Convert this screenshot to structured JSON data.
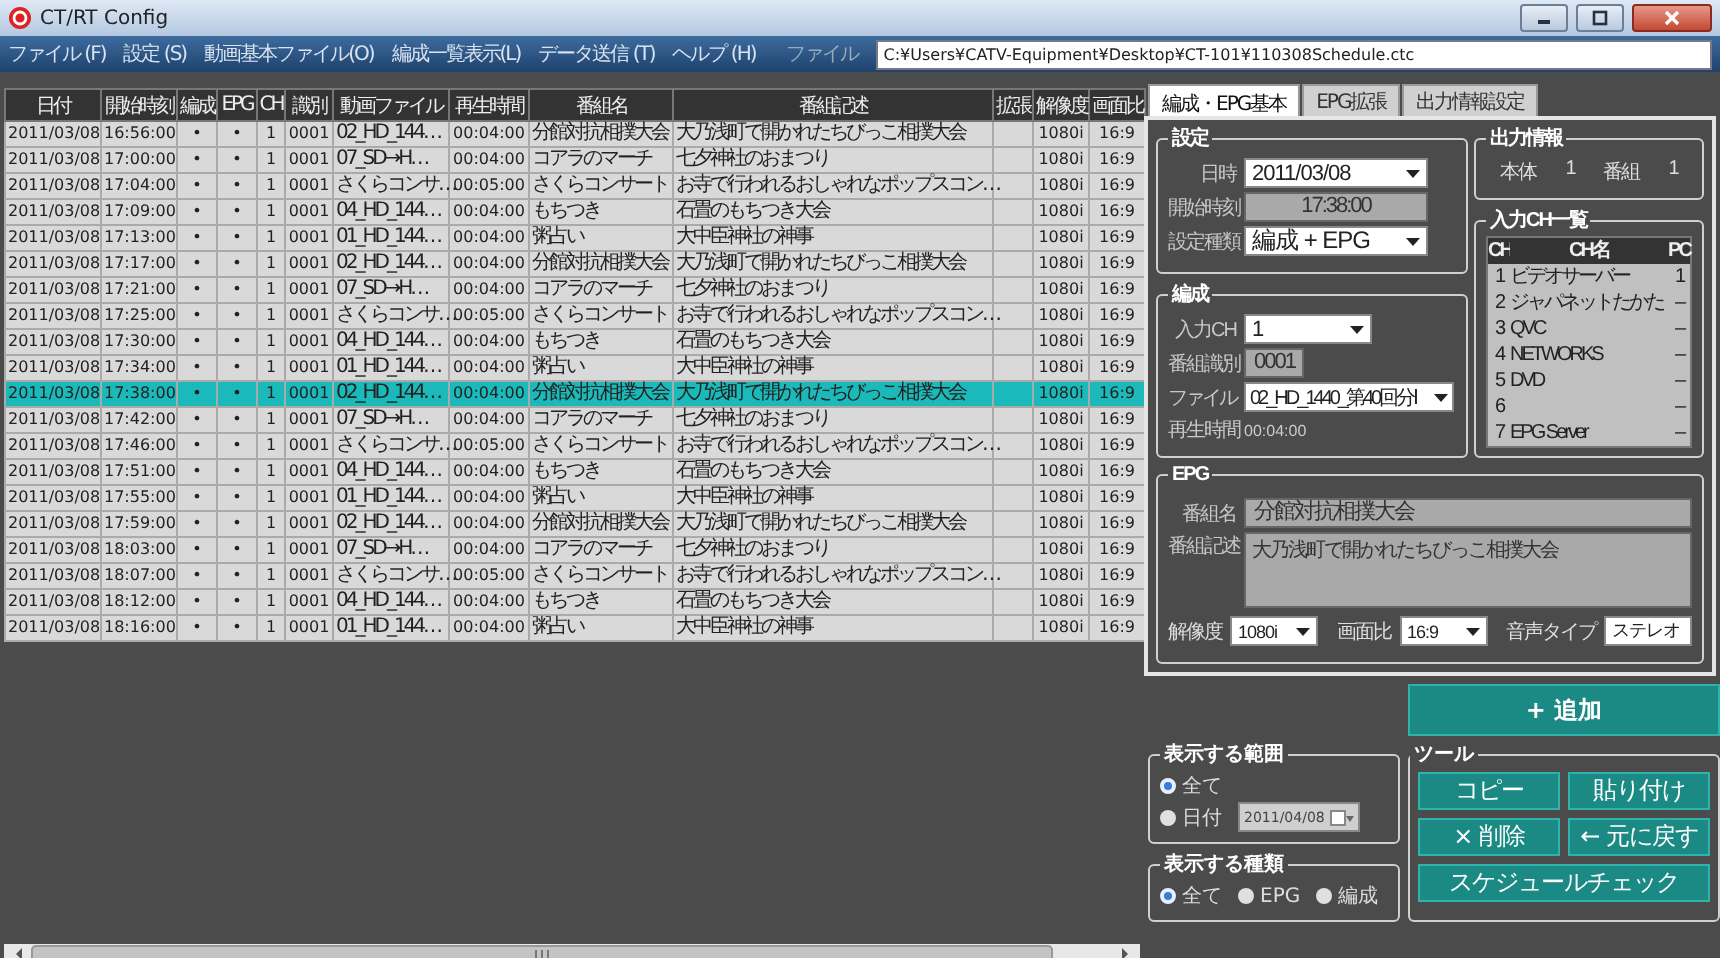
{
  "window": {
    "title": "CT/RT Config"
  },
  "menu": [
    "ファイル (F)",
    "設定 (S)",
    "動画基本ファイル(O)",
    "編成一覧表示(L)",
    "データ送信 (T)",
    "ヘルプ (H)"
  ],
  "file_path": {
    "label": "ファイル",
    "value": "C:¥Users¥CATV-Equipment¥Desktop¥CT-101¥110308Schedule.ctc"
  },
  "table": {
    "columns": [
      "日付",
      "開始時刻",
      "編成",
      "EPG",
      "CH",
      "識別",
      "動画ファイル",
      "再生時間",
      "番組名",
      "番組記述",
      "拡張",
      "解像度",
      "画面比"
    ],
    "rows": [
      {
        "selected": false,
        "cells": [
          "2011/03/08",
          "16:56:00",
          "•",
          "•",
          "1",
          "0001",
          "02_HD_144…",
          "00:04:00",
          "分館対抗相撲大会",
          "大乃浅町で開かれたちびっこ相撲大会",
          null,
          "1080i",
          "16:9"
        ]
      },
      {
        "selected": false,
        "cells": [
          "2011/03/08",
          "17:00:00",
          "•",
          "•",
          "1",
          "0001",
          "07_SD→H…",
          "00:04:00",
          "コアラのマーチ",
          "七夕神社のおまつり",
          null,
          "1080i",
          "16:9"
        ]
      },
      {
        "selected": false,
        "cells": [
          "2011/03/08",
          "17:04:00",
          "•",
          "•",
          "1",
          "0001",
          "さくらコンサ…",
          "00:05:00",
          "さくらコンサート",
          "お寺で行われるおしゃれなポップスコン…",
          null,
          "1080i",
          "16:9"
        ]
      },
      {
        "selected": false,
        "cells": [
          "2011/03/08",
          "17:09:00",
          "•",
          "•",
          "1",
          "0001",
          "04_HD_144…",
          "00:04:00",
          "もちつき",
          "石畳のもちつき大会",
          null,
          "1080i",
          "16:9"
        ]
      },
      {
        "selected": false,
        "cells": [
          "2011/03/08",
          "17:13:00",
          "•",
          "•",
          "1",
          "0001",
          "01_HD_144…",
          "00:04:00",
          "粥占い",
          "大中臣神社の神事",
          null,
          "1080i",
          "16:9"
        ]
      },
      {
        "selected": false,
        "cells": [
          "2011/03/08",
          "17:17:00",
          "•",
          "•",
          "1",
          "0001",
          "02_HD_144…",
          "00:04:00",
          "分館対抗相撲大会",
          "大乃浅町で開かれたちびっこ相撲大会",
          null,
          "1080i",
          "16:9"
        ]
      },
      {
        "selected": false,
        "cells": [
          "2011/03/08",
          "17:21:00",
          "•",
          "•",
          "1",
          "0001",
          "07_SD→H…",
          "00:04:00",
          "コアラのマーチ",
          "七夕神社のおまつり",
          null,
          "1080i",
          "16:9"
        ]
      },
      {
        "selected": false,
        "cells": [
          "2011/03/08",
          "17:25:00",
          "•",
          "•",
          "1",
          "0001",
          "さくらコンサ…",
          "00:05:00",
          "さくらコンサート",
          "お寺で行われるおしゃれなポップスコン…",
          null,
          "1080i",
          "16:9"
        ]
      },
      {
        "selected": false,
        "cells": [
          "2011/03/08",
          "17:30:00",
          "•",
          "•",
          "1",
          "0001",
          "04_HD_144…",
          "00:04:00",
          "もちつき",
          "石畳のもちつき大会",
          null,
          "1080i",
          "16:9"
        ]
      },
      {
        "selected": false,
        "cells": [
          "2011/03/08",
          "17:34:00",
          "•",
          "•",
          "1",
          "0001",
          "01_HD_144…",
          "00:04:00",
          "粥占い",
          "大中臣神社の神事",
          null,
          "1080i",
          "16:9"
        ]
      },
      {
        "selected": true,
        "cells": [
          "2011/03/08",
          "17:38:00",
          "•",
          "•",
          "1",
          "0001",
          "02_HD_144…",
          "00:04:00",
          "分館対抗相撲大会",
          "大乃浅町で開かれたちびっこ相撲大会",
          null,
          "1080i",
          "16:9"
        ]
      },
      {
        "selected": false,
        "cells": [
          "2011/03/08",
          "17:42:00",
          "•",
          "•",
          "1",
          "0001",
          "07_SD→H…",
          "00:04:00",
          "コアラのマーチ",
          "七夕神社のおまつり",
          null,
          "1080i",
          "16:9"
        ]
      },
      {
        "selected": false,
        "cells": [
          "2011/03/08",
          "17:46:00",
          "•",
          "•",
          "1",
          "0001",
          "さくらコンサ…",
          "00:05:00",
          "さくらコンサート",
          "お寺で行われるおしゃれなポップスコン…",
          null,
          "1080i",
          "16:9"
        ]
      },
      {
        "selected": false,
        "cells": [
          "2011/03/08",
          "17:51:00",
          "•",
          "•",
          "1",
          "0001",
          "04_HD_144…",
          "00:04:00",
          "もちつき",
          "石畳のもちつき大会",
          null,
          "1080i",
          "16:9"
        ]
      },
      {
        "selected": false,
        "cells": [
          "2011/03/08",
          "17:55:00",
          "•",
          "•",
          "1",
          "0001",
          "01_HD_144…",
          "00:04:00",
          "粥占い",
          "大中臣神社の神事",
          null,
          "1080i",
          "16:9"
        ]
      },
      {
        "selected": false,
        "cells": [
          "2011/03/08",
          "17:59:00",
          "•",
          "•",
          "1",
          "0001",
          "02_HD_144…",
          "00:04:00",
          "分館対抗相撲大会",
          "大乃浅町で開かれたちびっこ相撲大会",
          null,
          "1080i",
          "16:9"
        ]
      },
      {
        "selected": false,
        "cells": [
          "2011/03/08",
          "18:03:00",
          "•",
          "•",
          "1",
          "0001",
          "07_SD→H…",
          "00:04:00",
          "コアラのマーチ",
          "七夕神社のおまつり",
          null,
          "1080i",
          "16:9"
        ]
      },
      {
        "selected": false,
        "cells": [
          "2011/03/08",
          "18:07:00",
          "•",
          "•",
          "1",
          "0001",
          "さくらコンサ…",
          "00:05:00",
          "さくらコンサート",
          "お寺で行われるおしゃれなポップスコン…",
          null,
          "1080i",
          "16:9"
        ]
      },
      {
        "selected": false,
        "cells": [
          "2011/03/08",
          "18:12:00",
          "•",
          "•",
          "1",
          "0001",
          "04_HD_144…",
          "00:04:00",
          "もちつき",
          "石畳のもちつき大会",
          null,
          "1080i",
          "16:9"
        ]
      },
      {
        "selected": false,
        "cells": [
          "2011/03/08",
          "18:16:00",
          "•",
          "•",
          "1",
          "0001",
          "01_HD_144…",
          "00:04:00",
          "粥占い",
          "大中臣神社の神事",
          null,
          "1080i",
          "16:9"
        ]
      }
    ]
  },
  "tabs": [
    {
      "label": "編成・EPG基本",
      "selected": true
    },
    {
      "label": "EPG拡張",
      "selected": false
    },
    {
      "label": "出力情報設定",
      "selected": false
    }
  ],
  "settings": {
    "title": "設定",
    "date": {
      "label": "日時",
      "value": "2011/03/08"
    },
    "start_time": {
      "label": "開始時刻",
      "value": "17:38:00"
    },
    "type": {
      "label": "設定種類",
      "value": "編成 + EPG"
    }
  },
  "program": {
    "title": "編成",
    "input_ch": {
      "label": "入力CH",
      "value": "1"
    },
    "program_id": {
      "label": "番組識別",
      "value": "0001"
    },
    "file": {
      "label": "ファイル",
      "value": "02_HD_1440_第40回分Ⅰ"
    },
    "duration": {
      "label": "再生時間",
      "value": "00:04:00"
    }
  },
  "output_info": {
    "title": "出力情報",
    "items": [
      {
        "label": "本体",
        "value": "1"
      },
      {
        "label": "番組",
        "value": "1"
      }
    ]
  },
  "input_channels": {
    "title": "入力CH一覧",
    "columns": [
      "CH",
      "CH名",
      "PC"
    ],
    "rows": [
      {
        "ch": "1",
        "name": "ビデオサーバー",
        "pc": "1"
      },
      {
        "ch": "2",
        "name": "ジャパネットたかた",
        "pc": "–"
      },
      {
        "ch": "3",
        "name": "QVC",
        "pc": "–"
      },
      {
        "ch": "4",
        "name": "NETWORKS",
        "pc": "–"
      },
      {
        "ch": "5",
        "name": "DVD",
        "pc": "–"
      },
      {
        "ch": "6",
        "pc": "–"
      },
      {
        "ch": "7",
        "name": "EPG Server",
        "pc": "–"
      }
    ]
  },
  "epg": {
    "title": "EPG",
    "name": {
      "label": "番組名",
      "value": "分館対抗相撲大会"
    },
    "description": {
      "label": "番組記述",
      "value": "大乃浅町で開かれたちびっこ相撲大会"
    },
    "resolution": {
      "label": "解像度",
      "value": "1080i"
    },
    "aspect": {
      "label": "画面比",
      "value": "16:9"
    },
    "audio": {
      "label": "音声タイプ",
      "value": "ステレオ"
    }
  },
  "add_button": "+ 追加",
  "display_range": {
    "title": "表示する範囲",
    "options": [
      {
        "label": "全て",
        "selected": true
      },
      {
        "label": "日付",
        "selected": false
      }
    ],
    "date": {
      "value": "2011/04/08",
      "disabled": true
    }
  },
  "tools": {
    "title": "ツール",
    "buttons": [
      "コピー",
      "貼り付け",
      "× 削除",
      "← 元に戻す"
    ],
    "check_button": "スケジュールチェック"
  },
  "display_kind": {
    "title": "表示する種類",
    "options": [
      {
        "label": "全て",
        "selected": true
      },
      {
        "label": "EPG",
        "selected": false
      },
      {
        "label": "編成",
        "selected": false
      }
    ]
  }
}
